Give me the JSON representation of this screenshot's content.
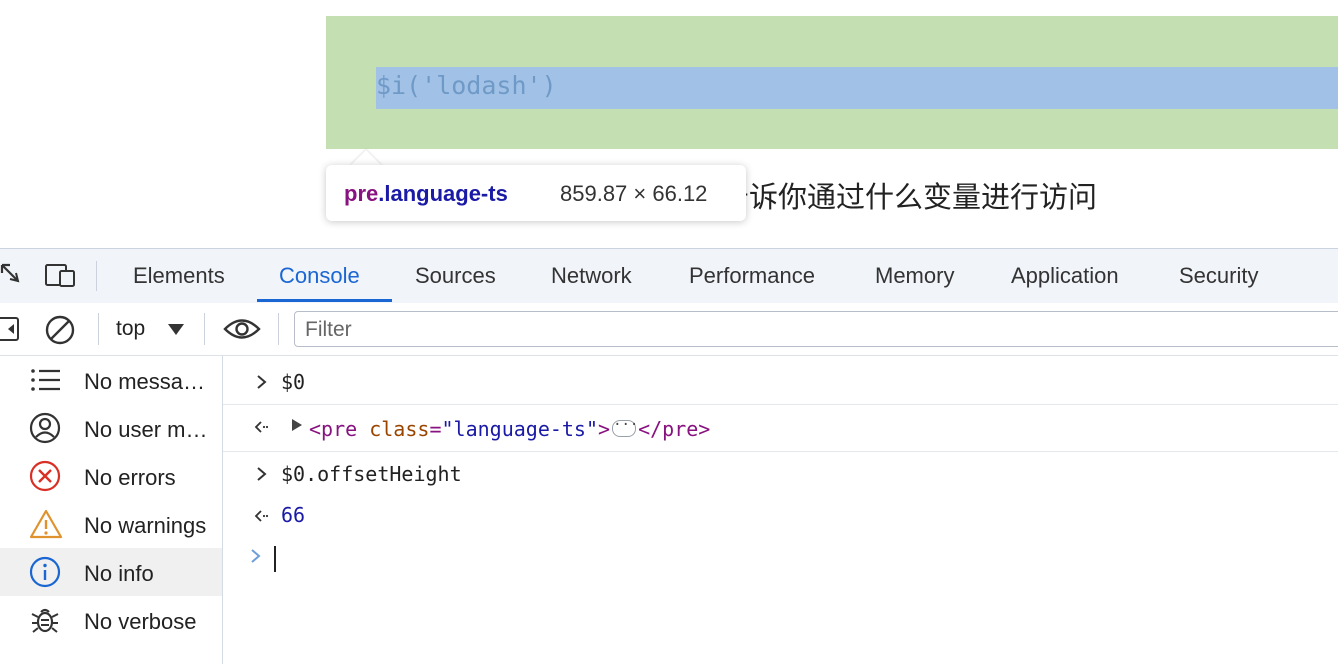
{
  "page": {
    "code_line": "$i('lodash')",
    "body_text": "告诉你通过什么变量进行访问"
  },
  "tooltip": {
    "tag": "pre",
    "class_name": ".language-ts",
    "dimensions": "859.87 × 66.12"
  },
  "devtools": {
    "tabs": [
      {
        "label": "Elements"
      },
      {
        "label": "Console",
        "active": true
      },
      {
        "label": "Sources"
      },
      {
        "label": "Network"
      },
      {
        "label": "Performance"
      },
      {
        "label": "Memory"
      },
      {
        "label": "Application"
      },
      {
        "label": "Security"
      }
    ],
    "toolbar": {
      "context": "top",
      "filter_placeholder": "Filter"
    },
    "sidebar": [
      {
        "label": "No messa…",
        "icon": "list-icon"
      },
      {
        "label": "No user m…",
        "icon": "user-icon"
      },
      {
        "label": "No errors",
        "icon": "error-icon"
      },
      {
        "label": "No warnings",
        "icon": "warning-icon"
      },
      {
        "label": "No info",
        "icon": "info-icon",
        "selected": true
      },
      {
        "label": "No verbose",
        "icon": "bug-icon"
      }
    ],
    "console": {
      "input1": "$0",
      "output1": {
        "open_tag": "<pre",
        "attr_name": "class",
        "eq": "=",
        "attr_value": "\"language-ts\"",
        "gt": ">",
        "ellipsis": "···",
        "close_tag": "</pre>"
      },
      "input2": "$0.offsetHeight",
      "output2": "66"
    }
  },
  "colors": {
    "pre_bg": "#c4dfb1",
    "selection": "#a1c2e6",
    "accent": "#1a66d2",
    "tag": "#881280",
    "attr": "#994500",
    "value": "#1a1aa6"
  }
}
